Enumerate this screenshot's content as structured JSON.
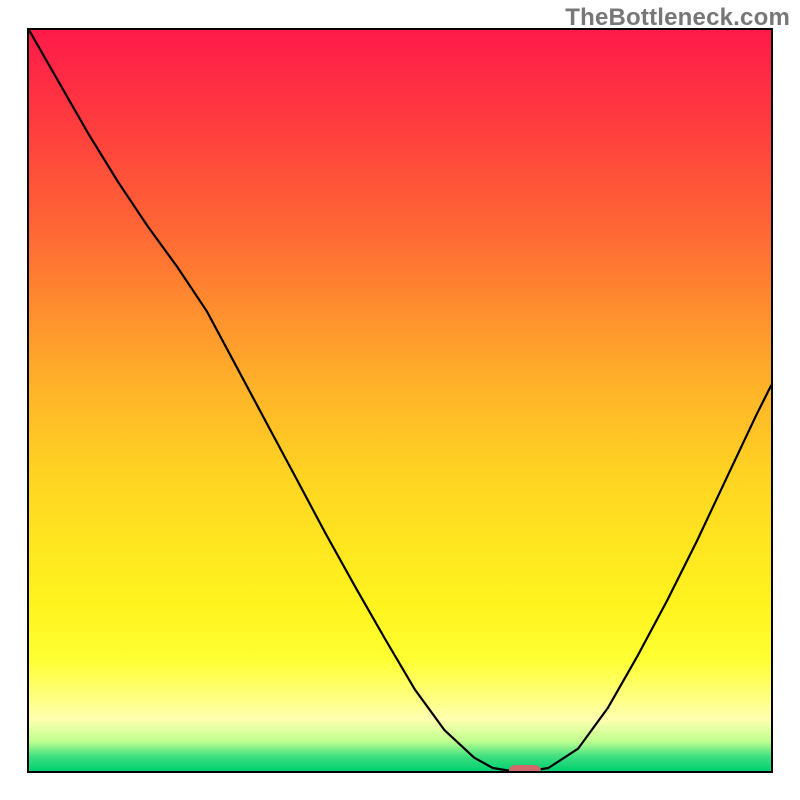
{
  "watermark": "TheBottleneck.com",
  "chart_data": {
    "type": "line",
    "title": "",
    "xlabel": "",
    "ylabel": "",
    "x": [
      0.0,
      0.04,
      0.08,
      0.12,
      0.16,
      0.2,
      0.24,
      0.28,
      0.32,
      0.36,
      0.4,
      0.44,
      0.48,
      0.52,
      0.56,
      0.6,
      0.625,
      0.65,
      0.675,
      0.7,
      0.74,
      0.78,
      0.82,
      0.86,
      0.9,
      0.94,
      0.98,
      1.0
    ],
    "values": [
      1.0,
      0.93,
      0.86,
      0.795,
      0.735,
      0.68,
      0.62,
      0.545,
      0.47,
      0.395,
      0.32,
      0.248,
      0.178,
      0.11,
      0.055,
      0.018,
      0.004,
      0.0,
      0.0,
      0.004,
      0.03,
      0.085,
      0.155,
      0.23,
      0.31,
      0.395,
      0.48,
      0.52
    ],
    "xlim": [
      0,
      1
    ],
    "ylim": [
      0,
      1
    ],
    "minimum_marker": {
      "x": 0.665,
      "y": 0.0,
      "color": "#d06a6a"
    },
    "background": "red-yellow-green vertical gradient",
    "legend": [],
    "grid": false
  }
}
